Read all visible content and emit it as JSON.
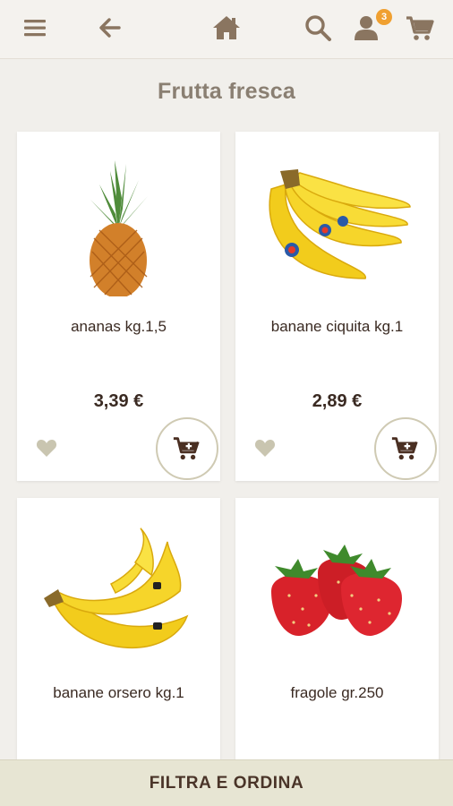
{
  "header": {
    "menu_icon": "hamburger-menu-icon",
    "back_icon": "arrow-left-icon",
    "home_icon": "home-icon",
    "search_icon": "search-icon",
    "user_icon": "user-icon",
    "user_badge": "3",
    "cart_icon": "shopping-cart-icon",
    "icon_color": "#8a7560",
    "badge_color": "#f0a030"
  },
  "page_title": "Frutta fresca",
  "products": [
    {
      "name": "ananas kg.1,5",
      "price": "3,39 €",
      "image": "pineapple"
    },
    {
      "name": "banane ciquita kg.1",
      "price": "2,89 €",
      "image": "bananas-chiquita"
    },
    {
      "name": "banane orsero kg.1",
      "price": "",
      "image": "bananas-orsero"
    },
    {
      "name": "fragole gr.250",
      "price": "",
      "image": "strawberries"
    }
  ],
  "footer": {
    "filter_label": "FILTRA E ORDINA"
  }
}
